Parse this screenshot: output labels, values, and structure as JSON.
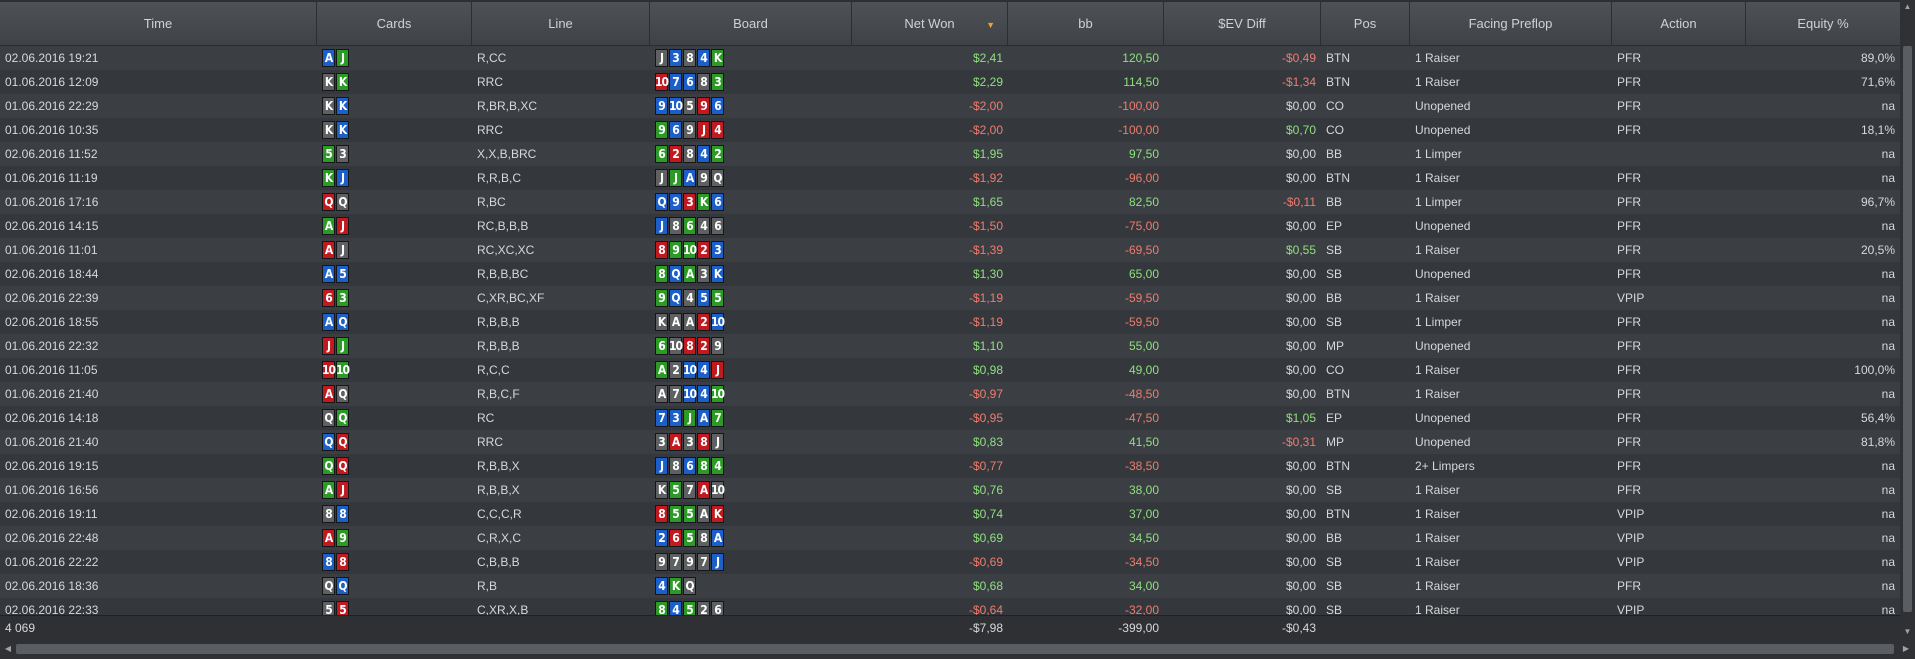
{
  "headers": {
    "time": "Time",
    "cards": "Cards",
    "line": "Line",
    "board": "Board",
    "net_won": "Net Won",
    "bb": "bb",
    "ev_diff": "$EV Diff",
    "pos": "Pos",
    "facing": "Facing Preflop",
    "action": "Action",
    "equity": "Equity %"
  },
  "sort_icon": "sort-descending-icon",
  "suit_colors": {
    "s": "#5e6062",
    "h": "#c0191f",
    "d": "#1d5fc9",
    "c": "#2d9a28"
  },
  "value_colors": {
    "positive": "#8fe07f",
    "negative": "#ee7d70"
  },
  "rows": [
    {
      "time": "02.06.2016 19:21",
      "cards": [
        [
          "A",
          "d"
        ],
        [
          "J",
          "c"
        ]
      ],
      "line": "R,CC",
      "board": [
        [
          "J",
          "s"
        ],
        [
          "3",
          "d"
        ],
        [
          "8",
          "s"
        ],
        [
          "4",
          "d"
        ],
        [
          "K",
          "c"
        ]
      ],
      "net": "$2,41",
      "bb": "120,50",
      "ev": "-$0,49",
      "pos": "BTN",
      "facing": "1 Raiser",
      "action": "PFR",
      "equity": "89,0%"
    },
    {
      "time": "01.06.2016 12:09",
      "cards": [
        [
          "K",
          "s"
        ],
        [
          "K",
          "c"
        ]
      ],
      "line": "RRC",
      "board": [
        [
          "10",
          "h"
        ],
        [
          "7",
          "d"
        ],
        [
          "6",
          "d"
        ],
        [
          "8",
          "s"
        ],
        [
          "3",
          "c"
        ]
      ],
      "net": "$2,29",
      "bb": "114,50",
      "ev": "-$1,34",
      "pos": "BTN",
      "facing": "1 Raiser",
      "action": "PFR",
      "equity": "71,6%"
    },
    {
      "time": "01.06.2016 22:29",
      "cards": [
        [
          "K",
          "s"
        ],
        [
          "K",
          "d"
        ]
      ],
      "line": "R,BR,B,XC",
      "board": [
        [
          "9",
          "d"
        ],
        [
          "10",
          "d"
        ],
        [
          "5",
          "s"
        ],
        [
          "9",
          "h"
        ],
        [
          "6",
          "d"
        ]
      ],
      "net": "-$2,00",
      "bb": "-100,00",
      "ev": "$0,00",
      "pos": "CO",
      "facing": "Unopened",
      "action": "PFR",
      "equity": "na"
    },
    {
      "time": "01.06.2016 10:35",
      "cards": [
        [
          "K",
          "s"
        ],
        [
          "K",
          "d"
        ]
      ],
      "line": "RRC",
      "board": [
        [
          "9",
          "c"
        ],
        [
          "6",
          "d"
        ],
        [
          "9",
          "s"
        ],
        [
          "J",
          "h"
        ],
        [
          "4",
          "h"
        ]
      ],
      "net": "-$2,00",
      "bb": "-100,00",
      "ev": "$0,70",
      "pos": "CO",
      "facing": "Unopened",
      "action": "PFR",
      "equity": "18,1%"
    },
    {
      "time": "02.06.2016 11:52",
      "cards": [
        [
          "5",
          "c"
        ],
        [
          "3",
          "s"
        ]
      ],
      "line": "X,X,B,BRC",
      "board": [
        [
          "6",
          "c"
        ],
        [
          "2",
          "h"
        ],
        [
          "8",
          "s"
        ],
        [
          "4",
          "d"
        ],
        [
          "2",
          "c"
        ]
      ],
      "net": "$1,95",
      "bb": "97,50",
      "ev": "$0,00",
      "pos": "BB",
      "facing": "1 Limper",
      "action": "",
      "equity": "na"
    },
    {
      "time": "01.06.2016 11:19",
      "cards": [
        [
          "K",
          "c"
        ],
        [
          "J",
          "d"
        ]
      ],
      "line": "R,R,B,C",
      "board": [
        [
          "J",
          "s"
        ],
        [
          "J",
          "c"
        ],
        [
          "A",
          "d"
        ],
        [
          "9",
          "s"
        ],
        [
          "Q",
          "s"
        ]
      ],
      "net": "-$1,92",
      "bb": "-96,00",
      "ev": "$0,00",
      "pos": "BTN",
      "facing": "1 Raiser",
      "action": "PFR",
      "equity": "na"
    },
    {
      "time": "01.06.2016 17:16",
      "cards": [
        [
          "Q",
          "h"
        ],
        [
          "Q",
          "s"
        ]
      ],
      "line": "R,BC",
      "board": [
        [
          "Q",
          "d"
        ],
        [
          "9",
          "d"
        ],
        [
          "3",
          "h"
        ],
        [
          "K",
          "c"
        ],
        [
          "6",
          "d"
        ]
      ],
      "net": "$1,65",
      "bb": "82,50",
      "ev": "-$0,11",
      "pos": "BB",
      "facing": "1 Limper",
      "action": "PFR",
      "equity": "96,7%"
    },
    {
      "time": "02.06.2016 14:15",
      "cards": [
        [
          "A",
          "c"
        ],
        [
          "J",
          "h"
        ]
      ],
      "line": "RC,B,B,B",
      "board": [
        [
          "J",
          "d"
        ],
        [
          "8",
          "s"
        ],
        [
          "6",
          "c"
        ],
        [
          "4",
          "s"
        ],
        [
          "6",
          "s"
        ]
      ],
      "net": "-$1,50",
      "bb": "-75,00",
      "ev": "$0,00",
      "pos": "EP",
      "facing": "Unopened",
      "action": "PFR",
      "equity": "na"
    },
    {
      "time": "01.06.2016 11:01",
      "cards": [
        [
          "A",
          "h"
        ],
        [
          "J",
          "s"
        ]
      ],
      "line": "RC,XC,XC",
      "board": [
        [
          "8",
          "h"
        ],
        [
          "9",
          "c"
        ],
        [
          "10",
          "c"
        ],
        [
          "2",
          "h"
        ],
        [
          "3",
          "d"
        ]
      ],
      "net": "-$1,39",
      "bb": "-69,50",
      "ev": "$0,55",
      "pos": "SB",
      "facing": "1 Raiser",
      "action": "PFR",
      "equity": "20,5%"
    },
    {
      "time": "02.06.2016 18:44",
      "cards": [
        [
          "A",
          "d"
        ],
        [
          "5",
          "d"
        ]
      ],
      "line": "R,B,B,BC",
      "board": [
        [
          "8",
          "c"
        ],
        [
          "Q",
          "d"
        ],
        [
          "A",
          "c"
        ],
        [
          "3",
          "s"
        ],
        [
          "K",
          "d"
        ]
      ],
      "net": "$1,30",
      "bb": "65,00",
      "ev": "$0,00",
      "pos": "SB",
      "facing": "Unopened",
      "action": "PFR",
      "equity": "na"
    },
    {
      "time": "02.06.2016 22:39",
      "cards": [
        [
          "6",
          "h"
        ],
        [
          "3",
          "c"
        ]
      ],
      "line": "C,XR,BC,XF",
      "board": [
        [
          "9",
          "c"
        ],
        [
          "Q",
          "d"
        ],
        [
          "4",
          "s"
        ],
        [
          "5",
          "d"
        ],
        [
          "5",
          "c"
        ]
      ],
      "net": "-$1,19",
      "bb": "-59,50",
      "ev": "$0,00",
      "pos": "BB",
      "facing": "1 Raiser",
      "action": "VPIP",
      "equity": "na"
    },
    {
      "time": "02.06.2016 18:55",
      "cards": [
        [
          "A",
          "d"
        ],
        [
          "Q",
          "d"
        ]
      ],
      "line": "R,B,B,B",
      "board": [
        [
          "K",
          "s"
        ],
        [
          "A",
          "s"
        ],
        [
          "A",
          "s"
        ],
        [
          "2",
          "h"
        ],
        [
          "10",
          "d"
        ]
      ],
      "net": "-$1,19",
      "bb": "-59,50",
      "ev": "$0,00",
      "pos": "SB",
      "facing": "1 Limper",
      "action": "PFR",
      "equity": "na"
    },
    {
      "time": "01.06.2016 22:32",
      "cards": [
        [
          "J",
          "h"
        ],
        [
          "J",
          "c"
        ]
      ],
      "line": "R,B,B,B",
      "board": [
        [
          "6",
          "c"
        ],
        [
          "10",
          "s"
        ],
        [
          "8",
          "h"
        ],
        [
          "2",
          "h"
        ],
        [
          "9",
          "s"
        ]
      ],
      "net": "$1,10",
      "bb": "55,00",
      "ev": "$0,00",
      "pos": "MP",
      "facing": "Unopened",
      "action": "PFR",
      "equity": "na"
    },
    {
      "time": "01.06.2016 11:05",
      "cards": [
        [
          "10",
          "h"
        ],
        [
          "10",
          "c"
        ]
      ],
      "line": "R,C,C",
      "board": [
        [
          "A",
          "c"
        ],
        [
          "2",
          "s"
        ],
        [
          "10",
          "d"
        ],
        [
          "4",
          "d"
        ],
        [
          "J",
          "h"
        ]
      ],
      "net": "$0,98",
      "bb": "49,00",
      "ev": "$0,00",
      "pos": "CO",
      "facing": "1 Raiser",
      "action": "PFR",
      "equity": "100,0%"
    },
    {
      "time": "01.06.2016 21:40",
      "cards": [
        [
          "A",
          "h"
        ],
        [
          "Q",
          "s"
        ]
      ],
      "line": "R,B,C,F",
      "board": [
        [
          "A",
          "s"
        ],
        [
          "7",
          "s"
        ],
        [
          "10",
          "d"
        ],
        [
          "4",
          "d"
        ],
        [
          "10",
          "c"
        ]
      ],
      "net": "-$0,97",
      "bb": "-48,50",
      "ev": "$0,00",
      "pos": "BTN",
      "facing": "1 Raiser",
      "action": "PFR",
      "equity": "na"
    },
    {
      "time": "02.06.2016 14:18",
      "cards": [
        [
          "Q",
          "s"
        ],
        [
          "Q",
          "c"
        ]
      ],
      "line": "RC",
      "board": [
        [
          "7",
          "d"
        ],
        [
          "3",
          "d"
        ],
        [
          "J",
          "c"
        ],
        [
          "A",
          "d"
        ],
        [
          "7",
          "c"
        ]
      ],
      "net": "-$0,95",
      "bb": "-47,50",
      "ev": "$1,05",
      "pos": "EP",
      "facing": "Unopened",
      "action": "PFR",
      "equity": "56,4%"
    },
    {
      "time": "01.06.2016 21:40",
      "cards": [
        [
          "Q",
          "d"
        ],
        [
          "Q",
          "h"
        ]
      ],
      "line": "RRC",
      "board": [
        [
          "3",
          "s"
        ],
        [
          "A",
          "h"
        ],
        [
          "3",
          "s"
        ],
        [
          "8",
          "h"
        ],
        [
          "J",
          "s"
        ]
      ],
      "net": "$0,83",
      "bb": "41,50",
      "ev": "-$0,31",
      "pos": "MP",
      "facing": "Unopened",
      "action": "PFR",
      "equity": "81,8%"
    },
    {
      "time": "02.06.2016 19:15",
      "cards": [
        [
          "Q",
          "c"
        ],
        [
          "Q",
          "h"
        ]
      ],
      "line": "R,B,B,X",
      "board": [
        [
          "J",
          "d"
        ],
        [
          "8",
          "s"
        ],
        [
          "6",
          "d"
        ],
        [
          "8",
          "c"
        ],
        [
          "4",
          "c"
        ]
      ],
      "net": "-$0,77",
      "bb": "-38,50",
      "ev": "$0,00",
      "pos": "BTN",
      "facing": "2+ Limpers",
      "action": "PFR",
      "equity": "na"
    },
    {
      "time": "01.06.2016 16:56",
      "cards": [
        [
          "A",
          "c"
        ],
        [
          "J",
          "h"
        ]
      ],
      "line": "R,B,B,X",
      "board": [
        [
          "K",
          "s"
        ],
        [
          "5",
          "c"
        ],
        [
          "7",
          "s"
        ],
        [
          "A",
          "h"
        ],
        [
          "10",
          "s"
        ]
      ],
      "net": "$0,76",
      "bb": "38,00",
      "ev": "$0,00",
      "pos": "SB",
      "facing": "1 Raiser",
      "action": "PFR",
      "equity": "na"
    },
    {
      "time": "02.06.2016 19:11",
      "cards": [
        [
          "8",
          "s"
        ],
        [
          "8",
          "d"
        ]
      ],
      "line": "C,C,C,R",
      "board": [
        [
          "8",
          "h"
        ],
        [
          "5",
          "c"
        ],
        [
          "5",
          "c"
        ],
        [
          "A",
          "s"
        ],
        [
          "K",
          "h"
        ]
      ],
      "net": "$0,74",
      "bb": "37,00",
      "ev": "$0,00",
      "pos": "BTN",
      "facing": "1 Raiser",
      "action": "VPIP",
      "equity": "na"
    },
    {
      "time": "02.06.2016 22:48",
      "cards": [
        [
          "A",
          "h"
        ],
        [
          "9",
          "c"
        ]
      ],
      "line": "C,R,X,C",
      "board": [
        [
          "2",
          "d"
        ],
        [
          "6",
          "h"
        ],
        [
          "5",
          "c"
        ],
        [
          "8",
          "s"
        ],
        [
          "A",
          "d"
        ]
      ],
      "net": "$0,69",
      "bb": "34,50",
      "ev": "$0,00",
      "pos": "BB",
      "facing": "1 Raiser",
      "action": "VPIP",
      "equity": "na"
    },
    {
      "time": "01.06.2016 22:22",
      "cards": [
        [
          "8",
          "d"
        ],
        [
          "8",
          "h"
        ]
      ],
      "line": "C,B,B,B",
      "board": [
        [
          "9",
          "s"
        ],
        [
          "7",
          "s"
        ],
        [
          "9",
          "s"
        ],
        [
          "7",
          "s"
        ],
        [
          "J",
          "d"
        ]
      ],
      "net": "-$0,69",
      "bb": "-34,50",
      "ev": "$0,00",
      "pos": "SB",
      "facing": "1 Raiser",
      "action": "VPIP",
      "equity": "na"
    },
    {
      "time": "02.06.2016 18:36",
      "cards": [
        [
          "Q",
          "s"
        ],
        [
          "Q",
          "d"
        ]
      ],
      "line": "R,B",
      "board": [
        [
          "4",
          "d"
        ],
        [
          "K",
          "c"
        ],
        [
          "Q",
          "s"
        ]
      ],
      "net": "$0,68",
      "bb": "34,00",
      "ev": "$0,00",
      "pos": "SB",
      "facing": "1 Raiser",
      "action": "PFR",
      "equity": "na"
    },
    {
      "time": "02.06.2016 22:33",
      "cards": [
        [
          "5",
          "s"
        ],
        [
          "5",
          "h"
        ]
      ],
      "line": "C,XR,X,B",
      "board": [
        [
          "8",
          "c"
        ],
        [
          "4",
          "d"
        ],
        [
          "5",
          "c"
        ],
        [
          "2",
          "s"
        ],
        [
          "6",
          "s"
        ]
      ],
      "net": "-$0,64",
      "bb": "-32,00",
      "ev": "$0,00",
      "pos": "SB",
      "facing": "1 Raiser",
      "action": "VPIP",
      "equity": "na"
    }
  ],
  "footer": {
    "count": "4 069",
    "net_total": "-$7,98",
    "bb_total": "-399,00",
    "ev_total": "-$0,43"
  },
  "scroll_icons": {
    "up": "scroll-up-icon",
    "down": "scroll-down-icon",
    "left": "scroll-left-icon",
    "right": "scroll-right-icon"
  }
}
